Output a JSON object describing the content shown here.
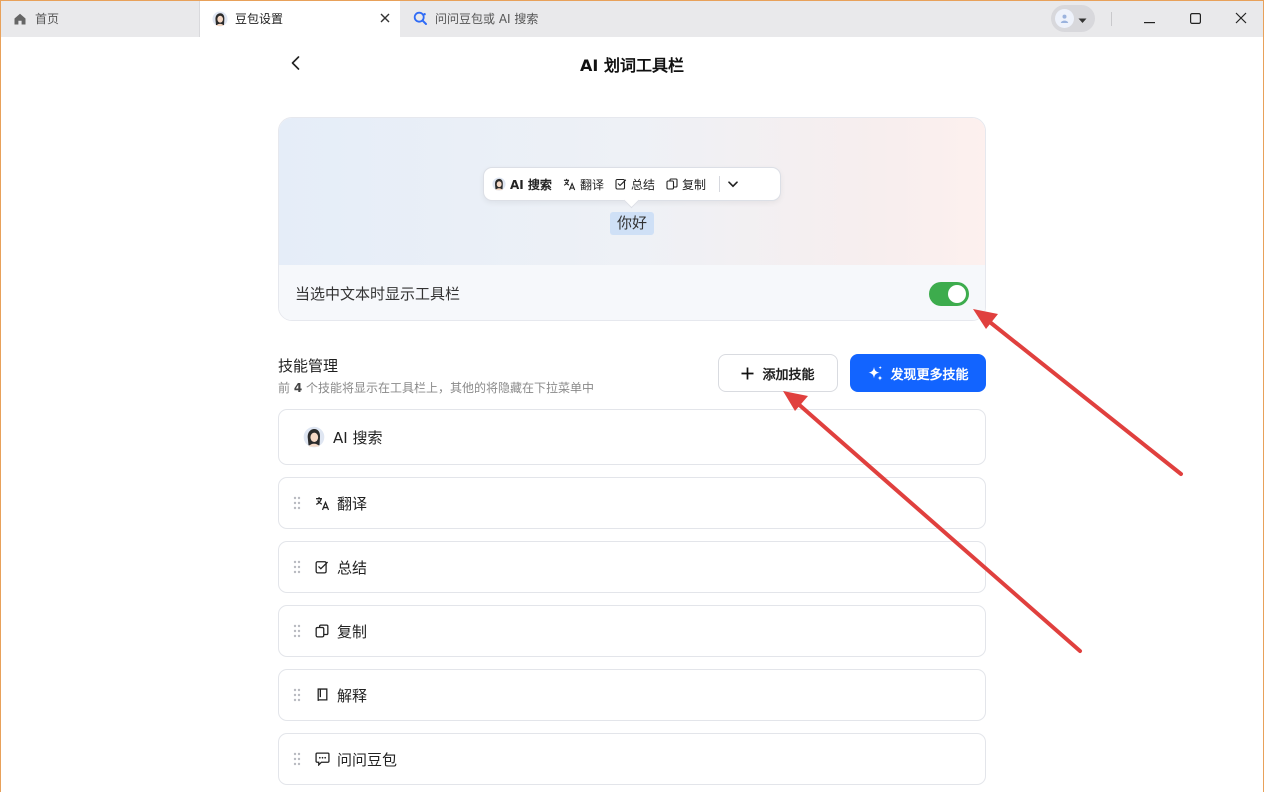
{
  "titlebar": {
    "tabs": [
      {
        "label": "首页",
        "icon": "home-icon"
      },
      {
        "label": "豆包设置",
        "icon": "doubao-avatar-icon",
        "active": true
      },
      {
        "label": "问问豆包或 AI 搜索",
        "icon": "search-icon"
      }
    ]
  },
  "page": {
    "title": "AI 划词工具栏"
  },
  "preview": {
    "toolbar_items": [
      "AI 搜索",
      "翻译",
      "总结",
      "复制"
    ],
    "sample_text": "你好",
    "toggle_label": "当选中文本时显示工具栏",
    "toggle_on": true,
    "toggle_color": "#3dac4d"
  },
  "skills": {
    "title": "技能管理",
    "desc_prefix": "前",
    "desc_count": "4",
    "desc_suffix": "个技能将显示在工具栏上，其他的将隐藏在下拉菜单中",
    "add_label": "添加技能",
    "discover_label": "发现更多技能",
    "discover_color": "#1264ff",
    "items": [
      {
        "label": "AI 搜索",
        "icon": "doubao-avatar-icon"
      },
      {
        "label": "翻译",
        "icon": "translate-icon"
      },
      {
        "label": "总结",
        "icon": "summary-icon"
      },
      {
        "label": "复制",
        "icon": "copy-icon"
      },
      {
        "label": "解释",
        "icon": "book-icon"
      },
      {
        "label": "问问豆包",
        "icon": "chat-icon"
      }
    ]
  },
  "annotations": {
    "arrow_color": "#e0403e"
  }
}
